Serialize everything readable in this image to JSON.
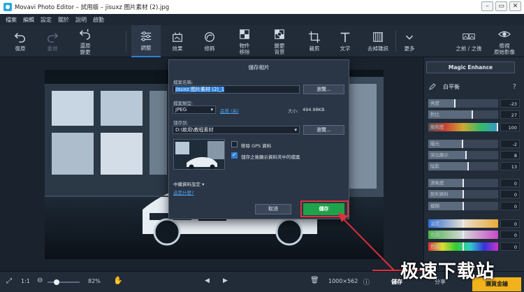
{
  "window": {
    "title": "Movavi Photo Editor – 試用版 – jisuxz 图片素材 (2).jpg",
    "min": "–",
    "max": "▭",
    "close": "✕"
  },
  "menu": [
    "檔案",
    "編輯",
    "設定",
    "關於",
    "說明",
    "啟動"
  ],
  "toolbar": {
    "undo": "復原",
    "redo": "重做",
    "restore": [
      "還原",
      "變更"
    ],
    "adjust": "調整",
    "effects": "效果",
    "retouch": "修飾",
    "remove_object": [
      "物件",
      "移除"
    ],
    "change_bg": [
      "變更",
      "背景"
    ],
    "crop": "裁剪",
    "text": "文字",
    "remove_noise": "去掉雜訊",
    "more": "更多",
    "before_after": "之前 / 之後",
    "view_original": [
      "檢視",
      "原始影像"
    ]
  },
  "right_panel": {
    "magic_enhance": "Magic Enhance",
    "section": "白平衡",
    "help": "?",
    "sliders": [
      {
        "label": "亮度",
        "value": "-23",
        "fill": 0.38
      },
      {
        "label": "對比",
        "value": "27",
        "fill": 0.63
      },
      {
        "label": "飽和度",
        "value": "100",
        "fill": 1.0
      },
      {
        "label": "曝光",
        "value": "-2",
        "fill": 0.49
      },
      {
        "label": "突出顯示",
        "value": "8",
        "fill": 0.54
      },
      {
        "label": "陰影",
        "value": "13",
        "fill": 0.57
      },
      {
        "label": "清晰度",
        "value": "0",
        "fill": 0.5
      },
      {
        "label": "銳利資料",
        "value": "0",
        "fill": 0.5
      },
      {
        "label": "模糊",
        "value": "0",
        "fill": 0.5
      },
      {
        "label": "溫度",
        "value": "0",
        "fill": 0.5
      },
      {
        "label": "色調",
        "value": "0",
        "fill": 0.5
      },
      {
        "label": "色調",
        "value": "0",
        "fill": 0.5
      }
    ]
  },
  "dialog": {
    "title": "儲存相片",
    "filename_label": "檔案名稱:",
    "filename_value": "jisuxz 图片素材 (2)_1",
    "browse": "瀏覽...",
    "filetype_label": "檔案類型:",
    "filetype_value": "JPEG",
    "quality_link": "品質 (高)",
    "size_label": "大小:",
    "size_value": "494.98KB",
    "saveto_label": "儲存到:",
    "saveto_value": "D:\\軟用\\教程素材",
    "browse2": "瀏覽...",
    "remove_gps": "移除 GPS 資料",
    "show_after_save": "儲存之後顯示資料夾中的檔案",
    "metadata": "中繼資料設定",
    "what_is_this": "這是什麼?",
    "cancel": "取消",
    "save": "儲存"
  },
  "status": {
    "ratio": "1:1",
    "zoom": "82%",
    "zoom_level": 0.28,
    "dimensions": "1000×562",
    "save": "儲存",
    "share": "分享",
    "buy": "購買金鑰"
  },
  "watermark": "极速下载站",
  "colors": {
    "accent": "#2f7fd4",
    "save_green": "#1fa34a",
    "buy_orange": "#f2b21b",
    "highlight": "#e0303a"
  }
}
